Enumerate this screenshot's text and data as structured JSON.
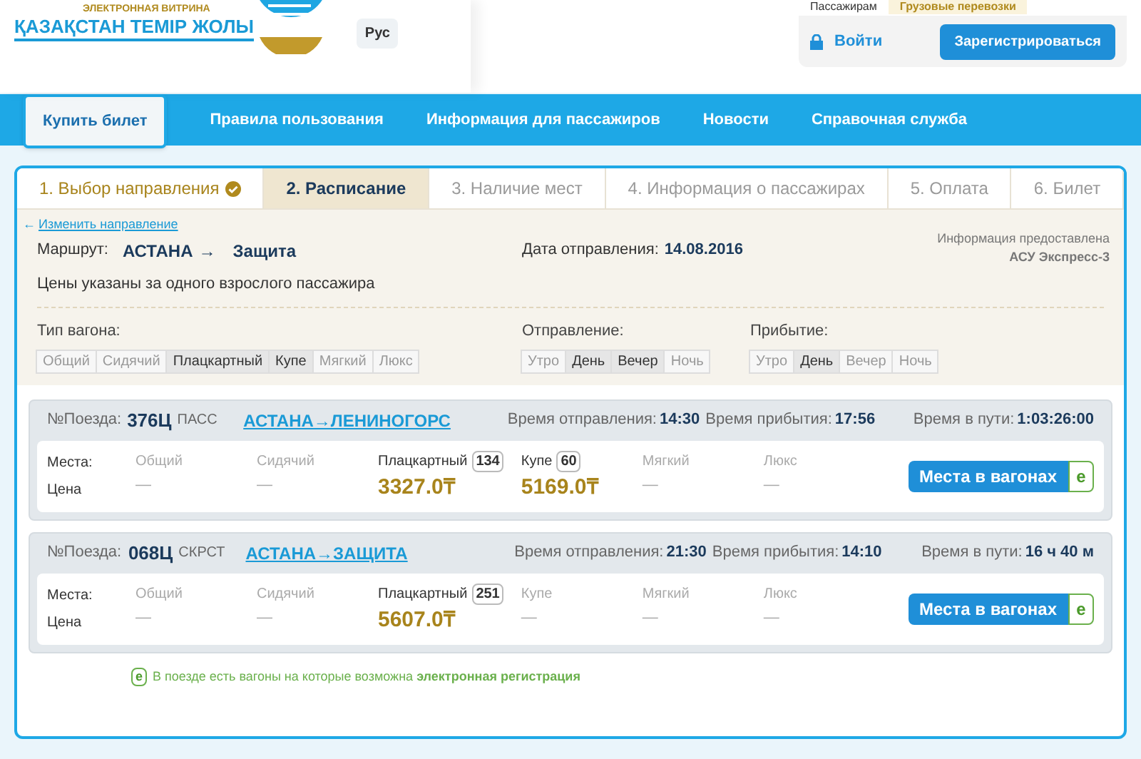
{
  "header": {
    "logo_subtitle": "ЭЛЕКТРОННАЯ ВИТРИНА",
    "logo_title": "ҚАЗАҚСТАН ТЕМІР ЖОЛЫ",
    "language": "Рус",
    "top_tabs": [
      {
        "label": "Пассажирам",
        "selected": true
      },
      {
        "label": "Грузовые перевозки",
        "selected": false
      }
    ],
    "login": "Войти",
    "register": "Зарегистрироваться"
  },
  "nav": [
    {
      "label": "Купить билет",
      "selected": true
    },
    {
      "label": "Правила пользования",
      "selected": false
    },
    {
      "label": "Информация для пассажиров",
      "selected": false
    },
    {
      "label": "Новости",
      "selected": false
    },
    {
      "label": "Справочная служба",
      "selected": false
    }
  ],
  "steps": [
    {
      "label": "1. Выбор направления",
      "completed": true,
      "selected": false
    },
    {
      "label": "2. Расписание",
      "completed": false,
      "selected": true
    },
    {
      "label": "3. Наличие мест",
      "completed": false,
      "selected": false
    },
    {
      "label": "4. Информация о пассажирах",
      "completed": false,
      "selected": false
    },
    {
      "label": "5. Оплата",
      "completed": false,
      "selected": false
    },
    {
      "label": "6. Билет",
      "completed": false,
      "selected": false
    }
  ],
  "change_link": {
    "arrow": "←",
    "label": "Изменить направление"
  },
  "route": {
    "label": "Маршрут:",
    "from": "АСТАНА",
    "arrow": "→",
    "to": "Защита"
  },
  "date": {
    "label": "Дата отправления:",
    "value": "14.08.2016"
  },
  "source": {
    "label": "Информация предоставлена",
    "value": "АСУ Экспресс-3"
  },
  "note": "Цены указаны за одного взрослого пассажира",
  "filters": [
    {
      "label": "Тип вагона:",
      "options": [
        {
          "label": "Общий",
          "selected": false
        },
        {
          "label": "Сидячий",
          "selected": false
        },
        {
          "label": "Плацкартный",
          "selected": true
        },
        {
          "label": "Купе",
          "selected": true
        },
        {
          "label": "Мягкий",
          "selected": false
        },
        {
          "label": "Люкс",
          "selected": false
        }
      ]
    },
    {
      "label": "Отправление:",
      "options": [
        {
          "label": "Утро",
          "selected": false
        },
        {
          "label": "День",
          "selected": true
        },
        {
          "label": "Вечер",
          "selected": true
        },
        {
          "label": "Ночь",
          "selected": false
        }
      ]
    },
    {
      "label": "Прибытие:",
      "options": [
        {
          "label": "Утро",
          "selected": false
        },
        {
          "label": "День",
          "selected": true
        },
        {
          "label": "Вечер",
          "selected": false
        },
        {
          "label": "Ночь",
          "selected": false
        }
      ]
    }
  ],
  "trains": [
    {
      "number_label": "№Поезда:",
      "number": "376Ц",
      "type": "ПАСС",
      "route": "АСТАНА→ЛЕНИНОГОРС",
      "departure_label": "Время отправления:",
      "departure": "14:30",
      "arrival_label": "Время прибытия:",
      "arrival": "17:56",
      "duration_label": "Время в пути:",
      "duration": "1:03:26:00",
      "seats_label": "Места:",
      "price_label": "Цена",
      "classes": [
        {
          "name": "Общий",
          "price": "—"
        },
        {
          "name": "Сидячий",
          "price": "—"
        },
        {
          "name": "Плацкартный",
          "count": "134",
          "price": "3327.0₸"
        },
        {
          "name": "Купе",
          "count": "60",
          "price": "5169.0₸"
        },
        {
          "name": "Мягкий",
          "price": "—"
        },
        {
          "name": "Люкс",
          "price": "—"
        }
      ],
      "button": "Места в вагонах",
      "e_badge": "e"
    },
    {
      "number_label": "№Поезда:",
      "number": "068Ц",
      "type": "СКРСТ",
      "route": "АСТАНА→ЗАЩИТА",
      "departure_label": "Время отправления:",
      "departure": "21:30",
      "arrival_label": "Время прибытия:",
      "arrival": "14:10",
      "duration_label": "Время в пути:",
      "duration": "16 ч 40 м",
      "seats_label": "Места:",
      "price_label": "Цена",
      "classes": [
        {
          "name": "Общий",
          "price": "—"
        },
        {
          "name": "Сидячий",
          "price": "—"
        },
        {
          "name": "Плацкартный",
          "count": "251",
          "price": "5607.0₸"
        },
        {
          "name": "Купе",
          "price": "—"
        },
        {
          "name": "Мягкий",
          "price": "—"
        },
        {
          "name": "Люкс",
          "price": "—"
        }
      ],
      "button": "Места в вагонах",
      "e_badge": "e"
    }
  ],
  "footnote": {
    "badge": "e",
    "text": "В поезде есть вагоны на которые возможна **электронная регистрация**"
  }
}
